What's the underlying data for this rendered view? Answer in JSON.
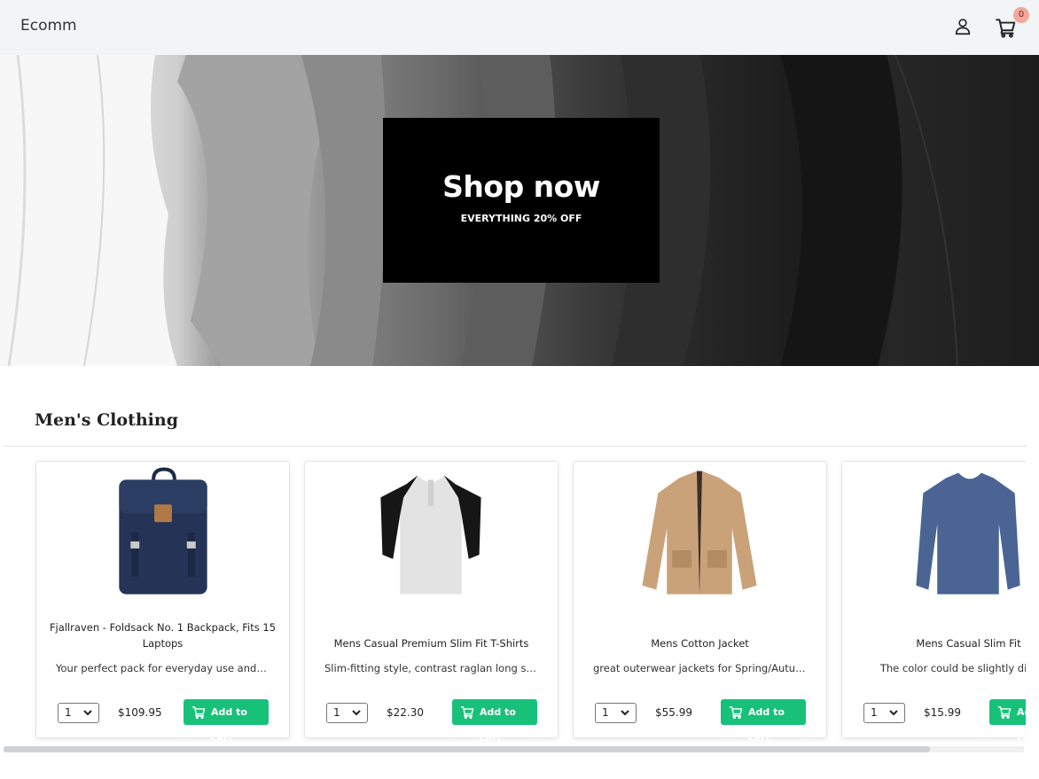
{
  "header": {
    "brand": "Ecomm",
    "cart_count": "0"
  },
  "hero": {
    "title": "Shop now",
    "subtitle": "EVERYTHING 20% OFF"
  },
  "section": {
    "title": "Men's Clothing"
  },
  "products": [
    {
      "name": "Fjallraven - Foldsack No. 1 Backpack, Fits 15 Laptops",
      "description": "Your perfect pack for everyday use and wal...",
      "qty": "1",
      "price": "$109.95",
      "button": "Add to cart",
      "image": "navy-backpack"
    },
    {
      "name": "Mens Casual Premium Slim Fit T-Shirts",
      "description": "Slim-fitting style, contrast raglan long sleev...",
      "qty": "1",
      "price": "$22.30",
      "button": "Add to cart",
      "image": "raglan-tshirt"
    },
    {
      "name": "Mens Cotton Jacket",
      "description": "great outerwear jackets for Spring/Autumn...",
      "qty": "1",
      "price": "$55.99",
      "button": "Add to cart",
      "image": "khaki-jacket"
    },
    {
      "name": "Mens Casual Slim Fit",
      "description": "The color could be slightly differen",
      "qty": "1",
      "price": "$15.99",
      "button": "Add to cart",
      "image": "blue-longsleeve"
    }
  ],
  "colors": {
    "accent": "#18c17a",
    "badge": "#f4a79a",
    "header_bg": "#f2f4f6"
  },
  "icons": {
    "user": "user-icon",
    "cart": "cart-icon",
    "chevron": "chevron-down-icon"
  }
}
